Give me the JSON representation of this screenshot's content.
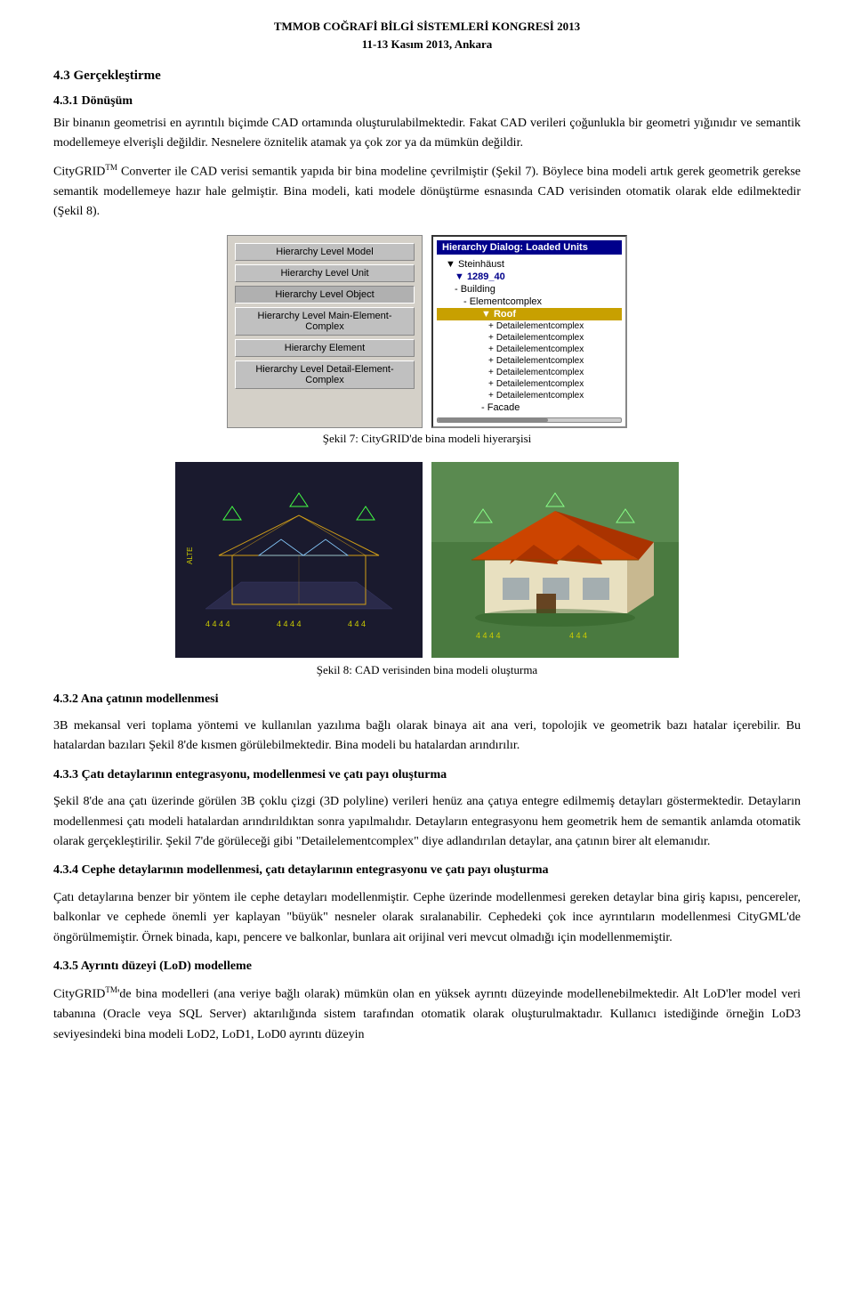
{
  "header": {
    "line1": "TMMOB COĞRAFİ BİLGİ SİSTEMLERİ KONGRESİ 2013",
    "line2": "11-13 Kasım 2013, Ankara"
  },
  "sections": {
    "s43": "4.3 Gerçekleştirme",
    "s431": "4.3.1 Dönüşüm",
    "p1": "Bir binanın geometrisi en ayrıntılı biçimde CAD ortamında oluşturulabilmektedir.",
    "p2": "Fakat CAD verileri çoğunlukla bir geometri yığınıdır ve semantik modellemeye elverişli değildir.",
    "p3": "Nesnelere öznitelik atamak ya çok zor ya da mümkün değildir.",
    "p4_part1": "CityGRID",
    "p4_tm": "TM",
    "p4_part2": " Converter ile CAD verisi semantik yapıda bir bina modeline çevrilmiştir (Şekil 7).",
    "p5": "Böylece bina modeli artık gerek geometrik gerekse semantik modellemeye hazır hale gelmiştir.",
    "p6": "Bina modeli, kati modele dönüştürme esnasında CAD verisinden otomatik olarak elde edilmektedir (Şekil 8).",
    "fig7_caption": "Şekil 7: CityGRID'de bina modeli hiyerarşisi",
    "fig8_caption": "Şekil 8: CAD verisinden bina modeli oluşturma",
    "s432": "4.3.2 Ana çatının modellenmesi",
    "p_432_1": "3B mekansal veri toplama yöntemi ve kullanılan yazılıma bağlı olarak binaya ait ana veri, topolojik ve geometrik bazı hatalar içerebilir. Bu hatalardan bazıları Şekil 8'de kısmen görülebilmektedir. Bina modeli bu hatalardan arındırılır.",
    "s433": "4.3.3 Çatı detaylarının entegrasyonu, modellenmesi ve çatı payı oluşturma",
    "p_433_1": "Şekil 8'de ana çatı üzerinde görülen 3B çoklu çizgi (3D polyline) verileri henüz ana çatıya entegre edilmemiş detayları göstermektedir. Detayların modellenmesi çatı modeli hatalardan arındırıldıktan sonra yapılmalıdır. Detayların entegrasyonu hem geometrik hem de semantik anlamda otomatik olarak gerçekleştirilir. Şekil 7'de görüleceği gibi \"Detailelementcomplex\" diye adlandırılan detaylar, ana çatının birer alt elemanıdır.",
    "s434": "4.3.4 Cephe detaylarının modellenmesi, çatı detaylarının entegrasyonu ve çatı payı oluşturma",
    "p_434_1": "Çatı detaylarına benzer bir yöntem ile cephe detayları modellenmiştir. Cephe üzerinde modellenmesi gereken detaylar bina giriş kapısı, pencereler, balkonlar ve cephede önemli yer kaplayan \"büyük\" nesneler olarak sıralanabilir. Cephedeki çok ince ayrıntıların modellenmesi CityGML'de öngörülmemiştir. Örnek binada, kapı, pencere ve balkonlar, bunlara ait orijinal veri mevcut olmadığı için modellenmemiştir.",
    "s435": "4.3.5 Ayrıntı düzeyi (LoD) modelleme",
    "p_435_1": "CityGRID",
    "p_435_tm": "TM",
    "p_435_2": "'de bina modelleri (ana veriye bağlı olarak)  mümkün olan en yüksek ayrıntı düzeyinde modellenebilmektedir. Alt LoD'ler model veri tabanına (Oracle veya SQL Server) aktarılığında sistem tarafından otomatik olarak oluşturulmaktadır. Kullanıcı istediğinde örneğin LoD3 seviyesindeki bina modeli LoD2, LoD1, LoD0 ayrıntı düzeyin",
    "hierarchy_buttons": [
      "Hierarchy Level Model",
      "Hierarchy Level Unit",
      "Hierarchy Level Object",
      "Hierarchy Level Main-Element-Complex",
      "Hierarchy Element",
      "Hierarchy Level Detail-Element-Complex"
    ],
    "tree_title": "Hierarchy Dialog: Loaded Units",
    "tree_items": [
      {
        "label": "Steinhäust",
        "level": 0
      },
      {
        "label": "1289_40",
        "level": 1,
        "selected": true
      },
      {
        "label": "Building",
        "level": 1
      },
      {
        "label": "Elementcomplex",
        "level": 2
      },
      {
        "label": "Roof",
        "level": 3,
        "highlight": true
      },
      {
        "label": "Detailelementcomplex",
        "level": 4
      },
      {
        "label": "Detailelementcomplex",
        "level": 4
      },
      {
        "label": "Detailelementcomplex",
        "level": 4
      },
      {
        "label": "Detailelementcomplex",
        "level": 4
      },
      {
        "label": "Detailelementcomplex",
        "level": 4
      },
      {
        "label": "Detailelementcomplex",
        "level": 4
      },
      {
        "label": "Detailelementcomplex",
        "level": 4
      },
      {
        "label": "Facade",
        "level": 3
      }
    ]
  }
}
